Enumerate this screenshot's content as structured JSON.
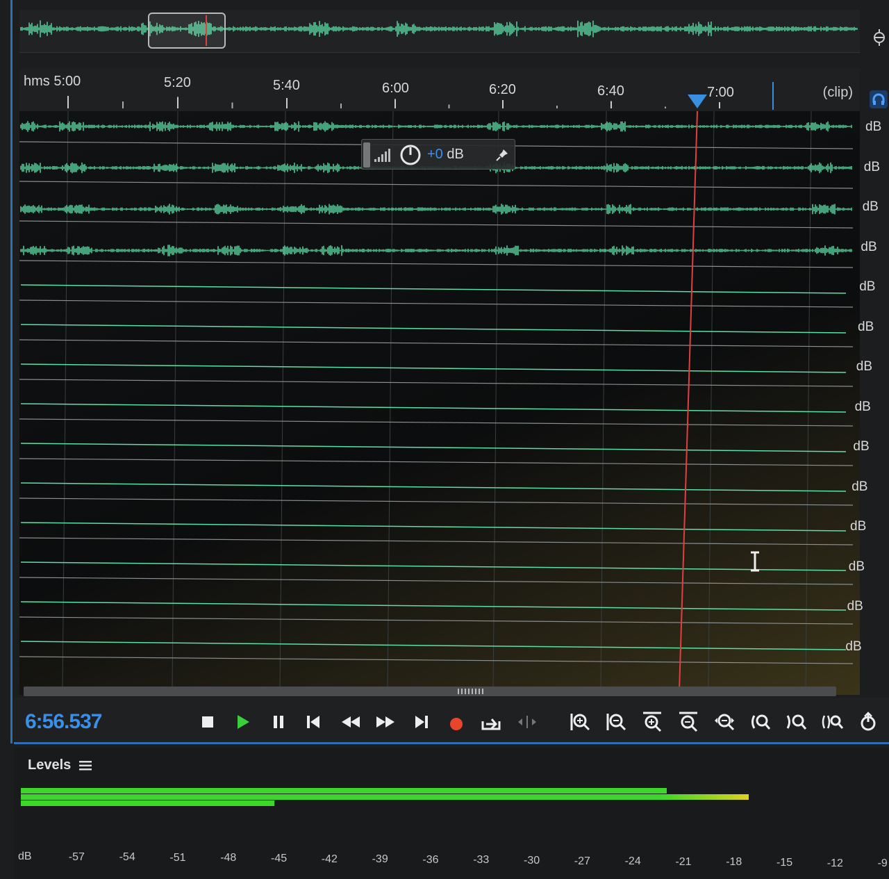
{
  "overview": {
    "label": "overview-waveform"
  },
  "ruler": {
    "labels": [
      "hms 5:00",
      "5:20",
      "5:40",
      "6:00",
      "6:20",
      "6:40",
      "7:00"
    ],
    "clip_label": "(clip)"
  },
  "tracks": {
    "db_label": "dB",
    "count": 14,
    "active_waveform_tracks": 4
  },
  "hud": {
    "value_number": "+0",
    "value_unit": " dB"
  },
  "transport": {
    "time": "6:56.537",
    "buttons": [
      "stop",
      "play",
      "pause",
      "move-to-previous",
      "rewind",
      "fast-forward",
      "move-to-next",
      "record",
      "skip-selection",
      "loop"
    ],
    "zoom_buttons": [
      "zoom-in-amplitude",
      "zoom-out-amplitude",
      "zoom-in-time",
      "zoom-out-time",
      "zoom-out-full",
      "zoom-in-at-start",
      "zoom-in-at-end",
      "zoom-to-selection",
      "zoom-reset"
    ]
  },
  "levels": {
    "title": "Levels",
    "scale": [
      "dB",
      "-57",
      "-54",
      "-51",
      "-48",
      "-45",
      "-42",
      "-39",
      "-36",
      "-33",
      "-30",
      "-27",
      "-24",
      "-21",
      "-18",
      "-15",
      "-12",
      "-9"
    ]
  },
  "colors": {
    "waveform": "#5de0a8",
    "playhead": "#e04040",
    "accent": "#3a8fe8",
    "meter_green": "#3dd62a",
    "meter_yellow": "#e0d020",
    "record": "#e8452c",
    "play": "#3ccf3c"
  }
}
